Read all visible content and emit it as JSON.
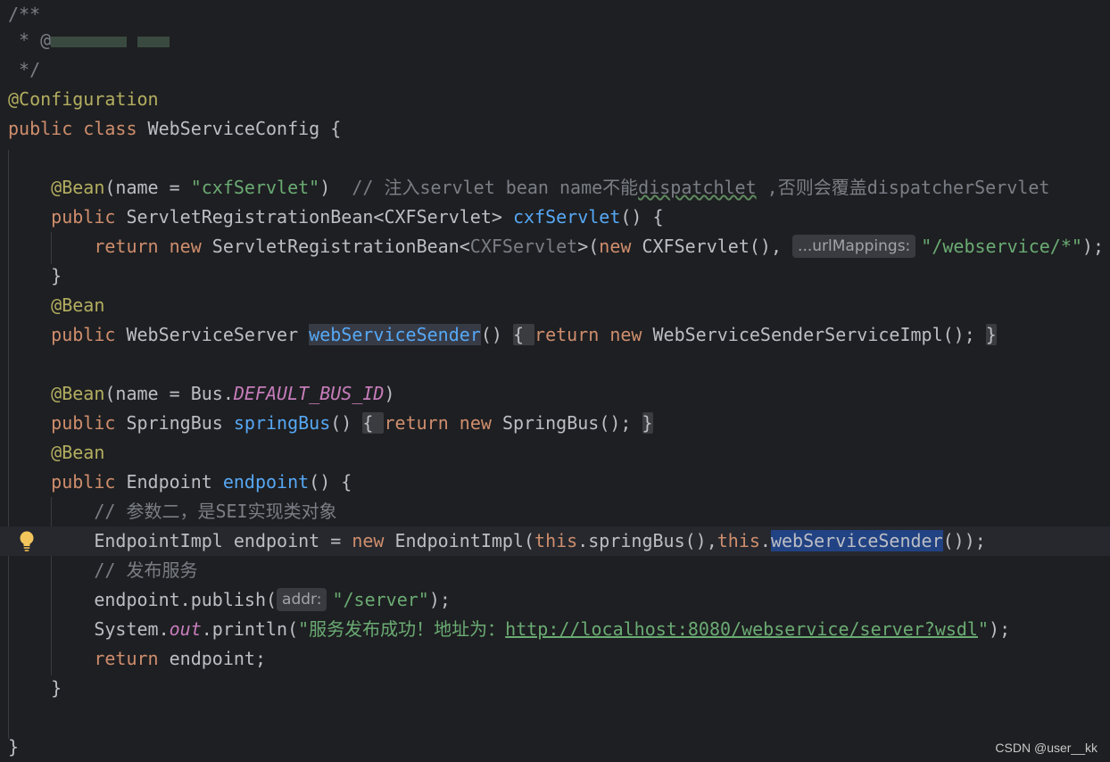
{
  "lines": {
    "l1": "/**",
    "l2": " * @",
    "l3": " */",
    "l4_ann": "@Configuration",
    "l5_kw1": "public ",
    "l5_kw2": "class ",
    "l5_rest": "WebServiceConfig {",
    "l7_ann": "@Bean",
    "l7_a": "(name = ",
    "l7_str": "\"cxfServlet\"",
    "l7_b": ")  ",
    "l7_cm1": "// 注入servlet bean name不能",
    "l7_cm2": "dispatchlet",
    "l7_cm3": " ,否则会覆盖dispatcherServlet",
    "l8_kw": "public ",
    "l8_type": "ServletRegistrationBean<CXFServlet> ",
    "l8_fn": "cxfServlet",
    "l8_rest": "() {",
    "l9_kw1": "return ",
    "l9_kw2": "new ",
    "l9_a": "ServletRegistrationBean<",
    "l9_gen": "CXFServlet",
    "l9_b": ">(",
    "l9_kw3": "new ",
    "l9_c": "CXFServlet(), ",
    "l9_hint": "...urlMappings:",
    "l9_str": "\"/webservice/*\"",
    "l9_end": ");",
    "l10": "}",
    "l11_ann": "@Bean",
    "l12_kw": "public ",
    "l12_type": "WebServiceServer ",
    "l12_fn": "webServiceSender",
    "l12_a": "() ",
    "l12_ob": "{ ",
    "l12_kw2": "return ",
    "l12_kw3": "new ",
    "l12_b": "WebServiceSenderServiceImpl(); ",
    "l12_cb": "}",
    "l14_ann": "@Bean",
    "l14_a": "(name = Bus.",
    "l14_st": "DEFAULT_BUS_ID",
    "l14_b": ")",
    "l15_kw": "public ",
    "l15_type": "SpringBus ",
    "l15_fn": "springBus",
    "l15_a": "() ",
    "l15_ob": "{ ",
    "l15_kw2": "return ",
    "l15_kw3": "new ",
    "l15_b": "SpringBus(); ",
    "l15_cb": "}",
    "l16_ann": "@Bean",
    "l17_kw": "public ",
    "l17_type": "Endpoint ",
    "l17_fn": "endpoint",
    "l17_rest": "() {",
    "l18_cm": "// 参数二，是SEI实现类对象",
    "l19_a": "EndpointImpl endpoint = ",
    "l19_kw": "new ",
    "l19_b": "EndpointImpl(",
    "l19_this1": "this",
    "l19_c": ".springBus(),",
    "l19_this2": "this",
    "l19_d": ".",
    "l19_sel": "webServiceSender",
    "l19_e": "());",
    "l20_cm": "// 发布服务",
    "l21_a": "endpoint.publish(",
    "l21_hint": "addr:",
    "l21_str": "\"/server\"",
    "l21_b": ");",
    "l22_a": "System.",
    "l22_st": "out",
    "l22_b": ".println(",
    "l22_str1": "\"服务发布成功！地址为：",
    "l22_url": "http://localhost:8080/webservice/server?wsdl",
    "l22_str2": "\"",
    "l22_c": ");",
    "l23_kw": "return ",
    "l23_rest": "endpoint;",
    "l24": "}",
    "l26": "}"
  },
  "watermark": "CSDN @user__kk",
  "icons": {
    "intention": "lightbulb-icon"
  }
}
